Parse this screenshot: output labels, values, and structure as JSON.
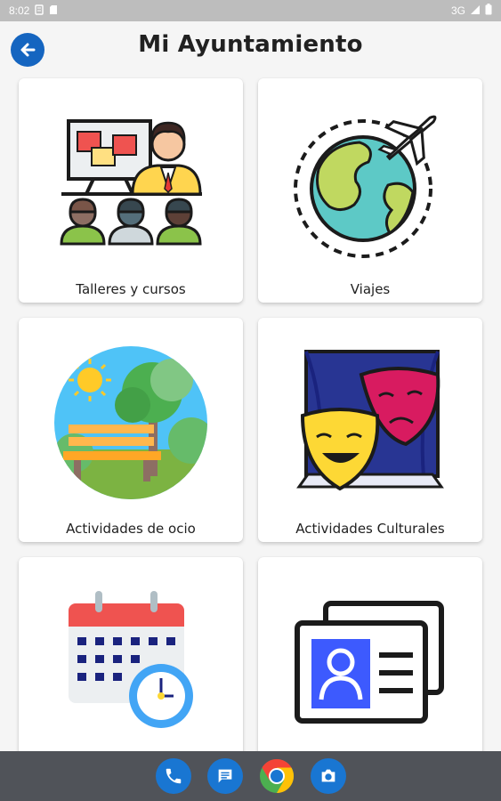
{
  "status_bar": {
    "time": "8:02",
    "network": "3G"
  },
  "header": {
    "title": "Mi Ayuntamiento",
    "back_icon": "arrow-left-icon"
  },
  "cards": [
    {
      "label": "Talleres y cursos",
      "icon": "workshop-classroom-icon"
    },
    {
      "label": "Viajes",
      "icon": "globe-airplane-icon"
    },
    {
      "label": "Actividades de ocio",
      "icon": "park-bench-tree-icon"
    },
    {
      "label": "Actividades Culturales",
      "icon": "theater-masks-icon"
    },
    {
      "label": "",
      "icon": "calendar-clock-icon"
    },
    {
      "label": "",
      "icon": "id-card-icon"
    }
  ],
  "dock": [
    {
      "icon": "phone-icon",
      "color": "#1976d2"
    },
    {
      "icon": "messages-icon",
      "color": "#1976d2"
    },
    {
      "icon": "chrome-icon",
      "color": "#4caf50"
    },
    {
      "icon": "camera-icon",
      "color": "#1976d2"
    }
  ],
  "colors": {
    "accent": "#1565c0",
    "status_bar": "#bdbdbd",
    "nav_bar": "#505359"
  }
}
